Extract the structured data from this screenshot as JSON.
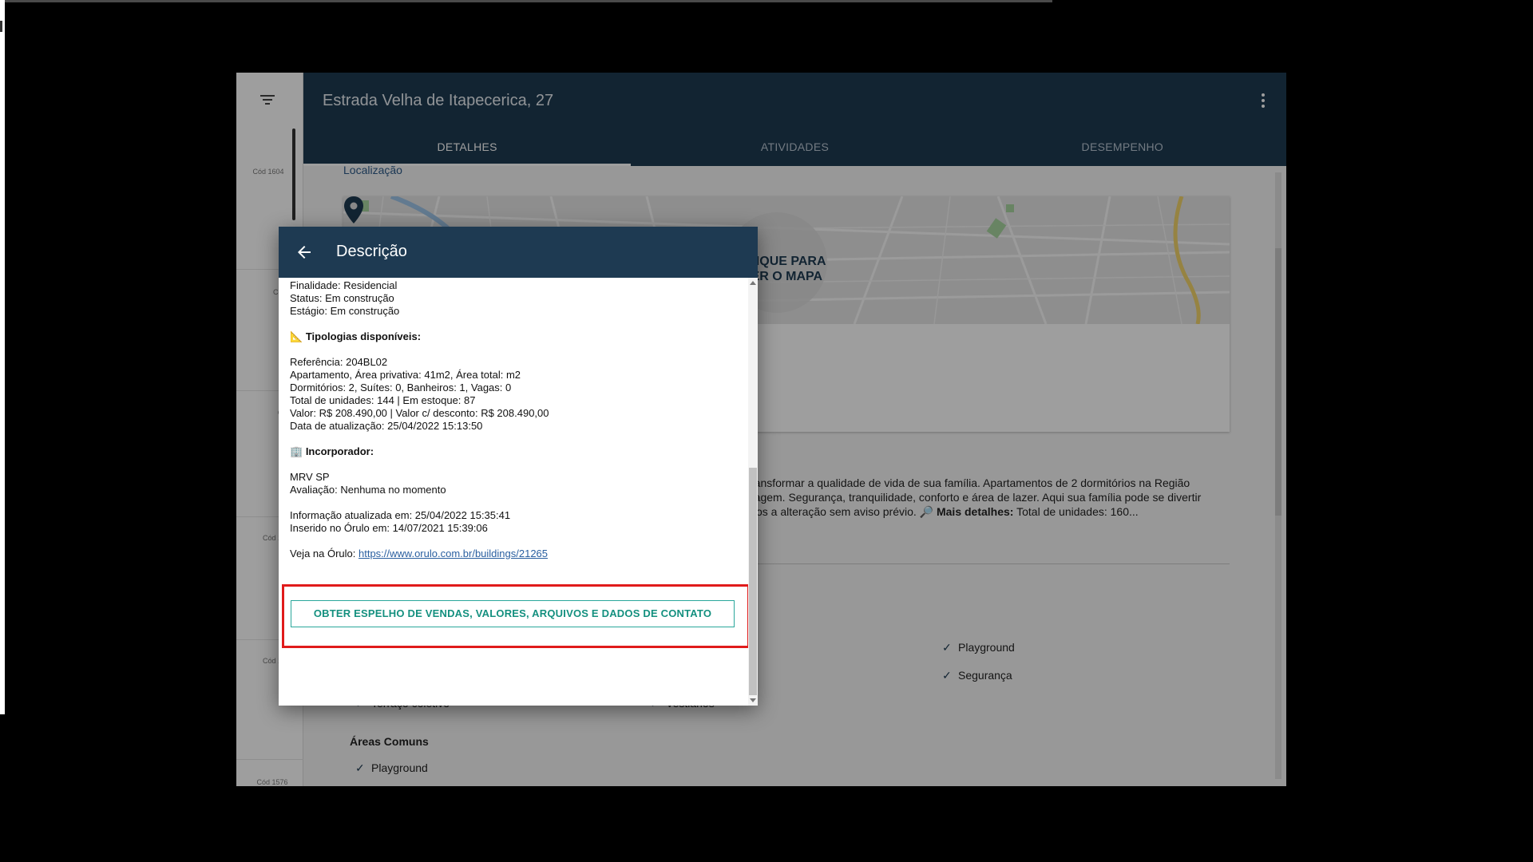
{
  "window": {
    "title": "Estrada Velha de Itapecerica, 27"
  },
  "leftcol": {
    "codes": [
      "Cód 1604",
      "Cód 1",
      "Cód",
      "Cód 156",
      "Cód 157",
      "Cód 1576"
    ]
  },
  "tabs": [
    {
      "label": "DETALHES",
      "active": true
    },
    {
      "label": "ATIVIDADES",
      "active": false
    },
    {
      "label": "DESEMPENHO",
      "active": false
    }
  ],
  "location": {
    "link_label": "Localização",
    "map_cta": "CLIQUE PARA VER O MAPA"
  },
  "background_description": {
    "line1": "ransformar a qualidade de vida de sua família. Apartamentos de 2 dormitórios na Região",
    "line2": "ragem. Segurança, tranquilidade, conforto e área de lazer. Aqui sua família pode se divertir",
    "line3_pre": "itos a alteração sem aviso prévio. 🔎 ",
    "line3_bold": "Mais detalhes:",
    "line3_post": " Total de unidades: 160..."
  },
  "features": {
    "right": [
      "Playground",
      "Segurança"
    ],
    "partial_left": "Terraço coletivo",
    "partial_mid": "Vestiários",
    "areas_title": "Áreas Comuns",
    "areas_items": [
      "Playground"
    ]
  },
  "dialog": {
    "title": "Descrição",
    "finalidade": "Finalidade: Residencial",
    "status": "Status: Em construção",
    "estagio": "Estágio: Em construção",
    "tipologias_icon": "📐",
    "tipologias_heading": "Tipologias disponíveis:",
    "referencia": "Referência: 204BL02",
    "area": "Apartamento, Área privativa: 41m2, Área total: m2",
    "dormitorios": "Dormitórios: 2, Suítes: 0, Banheiros: 1, Vagas: 0",
    "unidades": "Total de unidades: 144 | Em estoque: 87",
    "valor": "Valor: R$ 208.490,00 | Valor c/ desconto: R$ 208.490,00",
    "data_atualizacao": "Data de atualização: 25/04/2022 15:13:50",
    "incorporador_icon": "🏢",
    "incorporador_heading": "Incorporador:",
    "incorporador_nome": "MRV SP",
    "avaliacao": "Avaliação: Nenhuma no momento",
    "info_atualizada": "Informação atualizada em: 25/04/2022 15:35:41",
    "inserido": "Inserido no Órulo em: 14/07/2021 15:39:06",
    "veja_label": "Veja na Órulo: ",
    "veja_link": "https://www.orulo.com.br/buildings/21265",
    "cta_button": "OBTER ESPELHO DE VENDAS, VALORES, ARQUIVOS E DADOS DE CONTATO"
  },
  "icons": {
    "filter": "filter-icon",
    "kebab": "more-vert-icon",
    "back": "arrow-back-icon",
    "pin": "map-pin-icon",
    "check": "check-icon"
  },
  "colors": {
    "header": "#1e3a52",
    "cta": "#14907f",
    "highlight": "#e01b1b"
  }
}
